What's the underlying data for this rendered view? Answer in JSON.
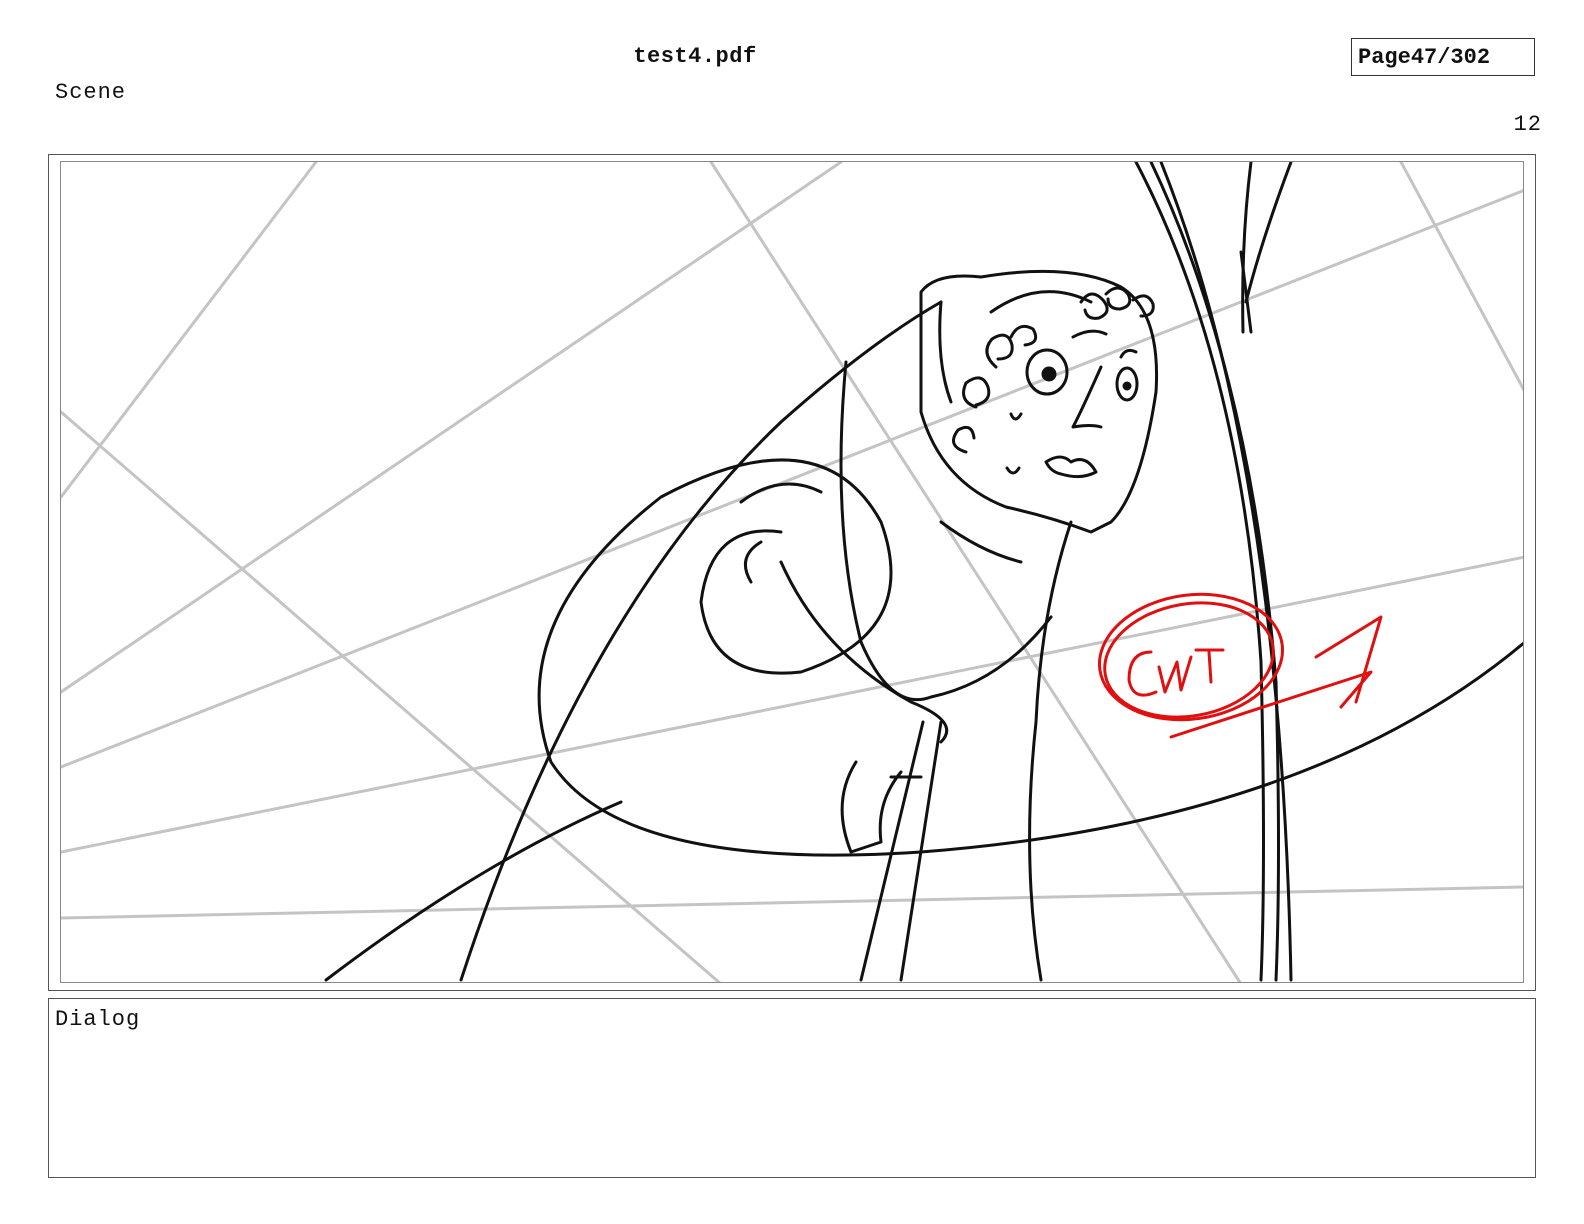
{
  "header": {
    "file_name": "test4.pdf",
    "page_label": "Page",
    "page_number": "47/302"
  },
  "scene": {
    "label": "Scene",
    "number": "12"
  },
  "panel": {
    "annotation_color": "#e01010",
    "guide_line_color": "#c4c4c4",
    "sketch_line_color": "#111111"
  },
  "dialog": {
    "label": "Dialog",
    "text": ""
  }
}
